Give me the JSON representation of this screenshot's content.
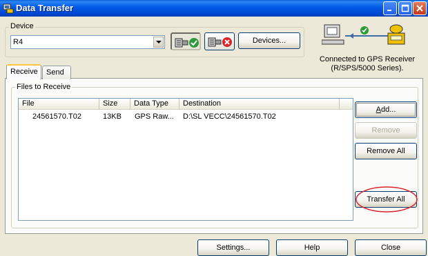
{
  "window": {
    "title": "Data Transfer"
  },
  "device": {
    "group_label": "Device",
    "selected": "R4",
    "devices_button": "Devices..."
  },
  "connection": {
    "status_line1": "Connected to GPS Receiver",
    "status_line2": "(R/SPS/5000 Series)."
  },
  "tabs": [
    {
      "label": "Receive",
      "active": true
    },
    {
      "label": "Send",
      "active": false
    }
  ],
  "files": {
    "group_label": "Files to Receive",
    "columns": [
      "File",
      "Size",
      "Data Type",
      "Destination"
    ],
    "rows": [
      {
        "file": "24561570.T02",
        "size": "13KB",
        "type": "GPS Raw...",
        "destination": "D:\\SL VECC\\24561570.T02"
      }
    ]
  },
  "actions": {
    "add_prefix": "A",
    "add_rest": "dd...",
    "remove": "Remove",
    "remove_all": "Remove All",
    "transfer_all": "Transfer All"
  },
  "footer": {
    "settings": "Settings...",
    "help": "Help",
    "close": "Close"
  },
  "colors": {
    "titlebar": "#0058e6",
    "annotation": "#d9252a",
    "connected": "#2e9a3b",
    "disconnected": "#d9252a"
  }
}
